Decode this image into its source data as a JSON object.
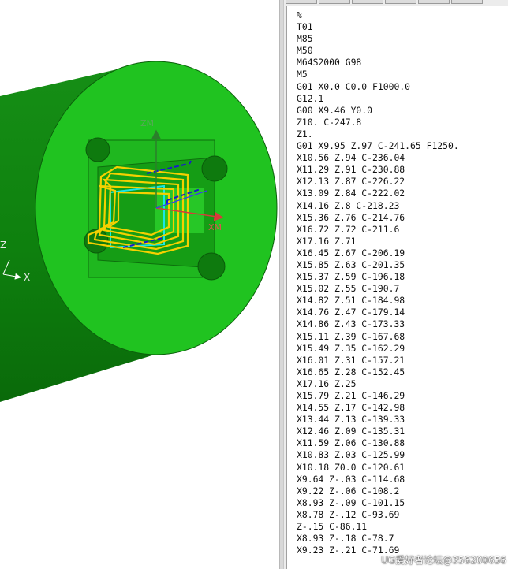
{
  "viewport": {
    "triad_labels": {
      "x": "X",
      "z": "Z"
    },
    "csys_labels": {
      "xm": "XM",
      "zm": "ZM"
    },
    "colors": {
      "background": "#ffffff",
      "part_body": "#0f8a0f",
      "part_face": "#1fc21f",
      "toolpath": "#f5d000",
      "axis_x": "#d83a3a",
      "axis_z": "#2b7f2b",
      "rapid": "#1a1acc"
    }
  },
  "nc_program": {
    "lines": [
      "%",
      "T01",
      "M85",
      "M50",
      "M64S2000 G98",
      "M5",
      "G01 X0.0 C0.0 F1000.0",
      "G12.1",
      "G00 X9.46 Y0.0",
      "Z10. C-247.8",
      "Z1.",
      "G01 X9.95 Z.97 C-241.65 F1250.",
      "X10.56 Z.94 C-236.04",
      "X11.29 Z.91 C-230.88",
      "X12.13 Z.87 C-226.22",
      "X13.09 Z.84 C-222.02",
      "X14.16 Z.8 C-218.23",
      "X15.36 Z.76 C-214.76",
      "X16.72 Z.72 C-211.6",
      "X17.16 Z.71",
      "X16.45 Z.67 C-206.19",
      "X15.85 Z.63 C-201.35",
      "X15.37 Z.59 C-196.18",
      "X15.02 Z.55 C-190.7",
      "X14.82 Z.51 C-184.98",
      "X14.76 Z.47 C-179.14",
      "X14.86 Z.43 C-173.33",
      "X15.11 Z.39 C-167.68",
      "X15.49 Z.35 C-162.29",
      "X16.01 Z.31 C-157.21",
      "X16.65 Z.28 C-152.45",
      "X17.16 Z.25",
      "X15.79 Z.21 C-146.29",
      "X14.55 Z.17 C-142.98",
      "X13.44 Z.13 C-139.33",
      "X12.46 Z.09 C-135.31",
      "X11.59 Z.06 C-130.88",
      "X10.83 Z.03 C-125.99",
      "X10.18 Z0.0 C-120.61",
      "X9.64 Z-.03 C-114.68",
      "X9.22 Z-.06 C-108.2",
      "X8.93 Z-.09 C-101.15",
      "X8.78 Z-.12 C-93.69",
      "Z-.15 C-86.11",
      "X8.93 Z-.18 C-78.7",
      "X9.23 Z-.21 C-71.69"
    ]
  },
  "watermark": "UG爱好者论坛@356200656"
}
